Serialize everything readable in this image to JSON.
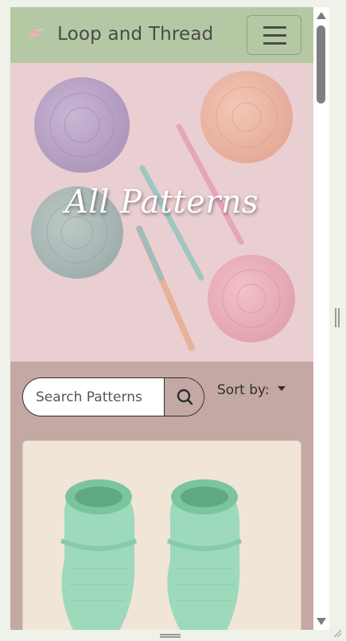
{
  "navbar": {
    "brand": "Loop and Thread",
    "logo_icon": "yarn-ball-icon",
    "menu_icon": "hamburger-menu-icon"
  },
  "hero": {
    "title": "All Patterns",
    "image": "yarn-and-crochet-hooks-photo"
  },
  "search": {
    "placeholder": "Search Patterns",
    "icon": "search-icon"
  },
  "sort": {
    "label": "Sort by:"
  },
  "card": {
    "image": "mint-crochet-baby-booties-photo"
  },
  "colors": {
    "navbar_bg": "#b5c8a4",
    "page_bg": "#c4a8a3",
    "hero_bg": "#eccfd3",
    "card_bg": "#f0e5d6"
  }
}
